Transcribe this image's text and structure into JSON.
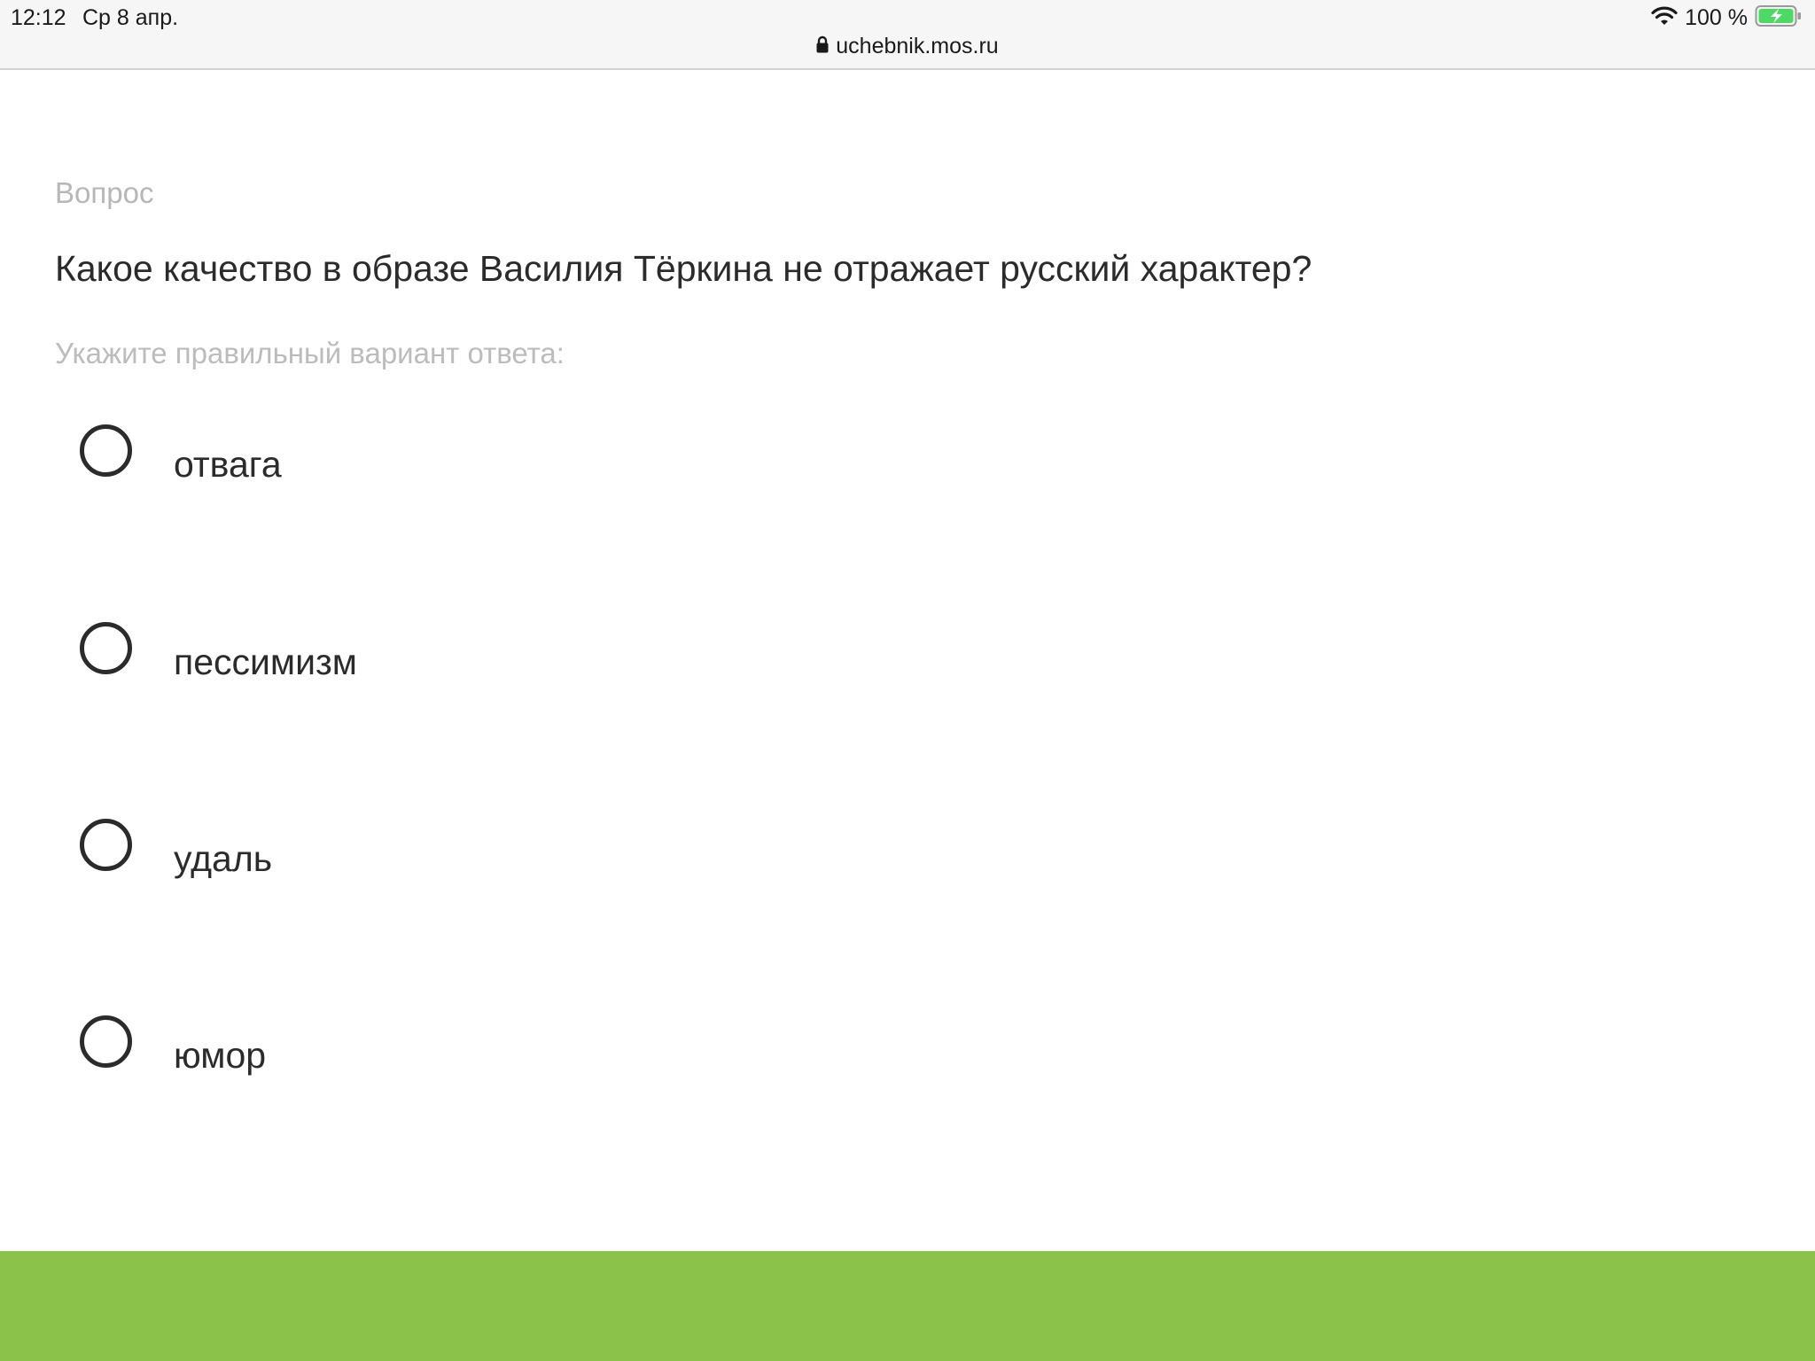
{
  "status_bar": {
    "time": "12:12",
    "date": "Ср 8 апр.",
    "battery": "100 %",
    "icons": [
      "wifi-icon",
      "battery-charging-icon"
    ]
  },
  "browser": {
    "url": "uchebnik.mos.ru",
    "lock_icon": "lock-icon"
  },
  "question": {
    "label": "Вопрос",
    "text": "Какое качество в образе Василия Тёркина не отражает русский характер?",
    "hint": "Укажите правильный вариант ответа:",
    "options": [
      {
        "label": "отвага"
      },
      {
        "label": "пессимизм"
      },
      {
        "label": "удаль"
      },
      {
        "label": "юмор"
      }
    ]
  },
  "colors": {
    "footer": "#8bc34a",
    "battery_fill": "#4cd964",
    "text": "#2b2b2b",
    "muted": "#b7b7b7"
  }
}
